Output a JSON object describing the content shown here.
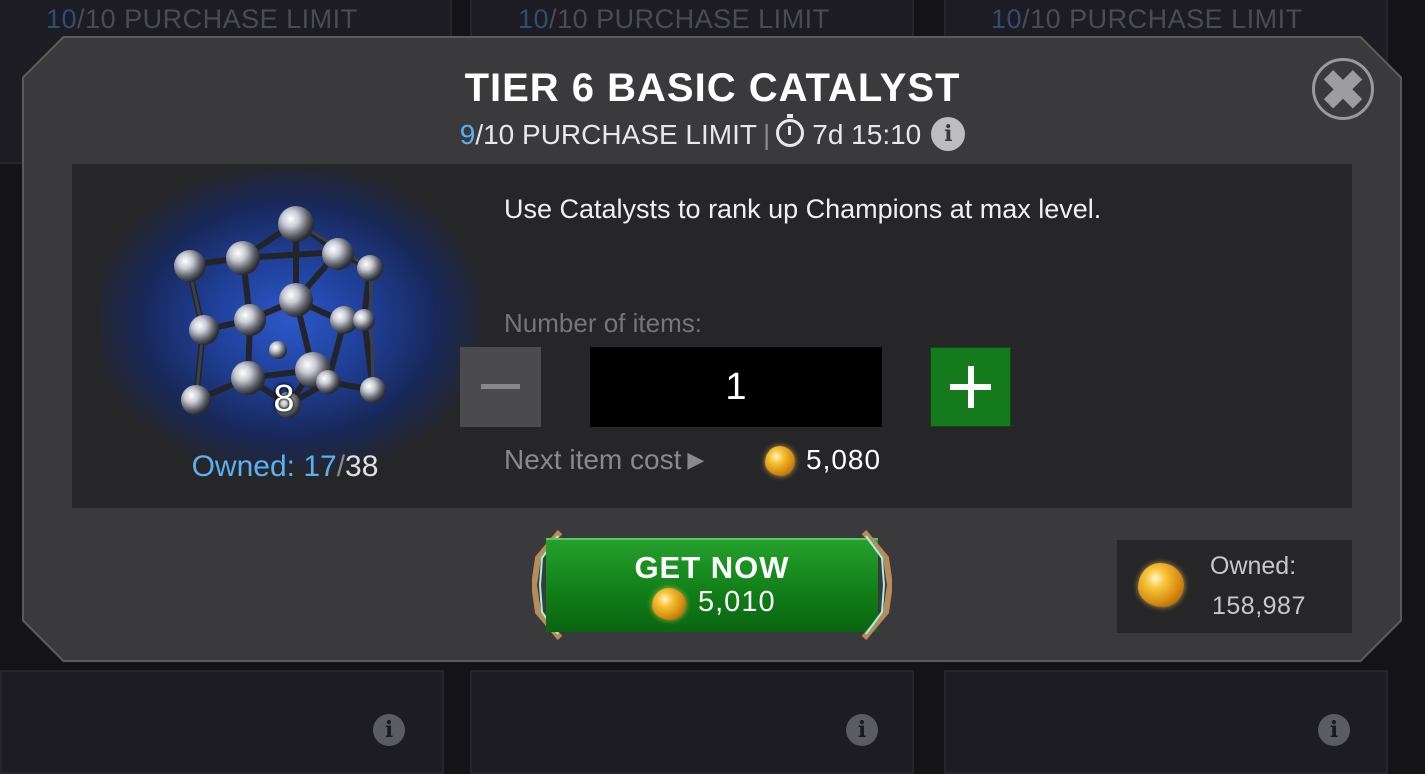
{
  "background": {
    "purchase_limits": [
      {
        "current": "10",
        "slash": "/",
        "text": "10 PURCHASE LIMIT"
      },
      {
        "current": "10",
        "slash": "/",
        "text": "10 PURCHASE LIMIT"
      },
      {
        "current": "10",
        "slash": "/",
        "text": "10 PURCHASE LIMIT"
      }
    ],
    "info_glyph": "i"
  },
  "modal": {
    "title": "TIER 6 BASIC CATALYST",
    "limit_current": "9",
    "limit_rest": "/10 PURCHASE LIMIT",
    "separator": "|",
    "timer": "7d 15:10",
    "info_glyph": "i",
    "close_glyph": "✖",
    "description": "Use Catalysts to rank up Champions at max level.",
    "item": {
      "icon": "catalyst-icon",
      "count": "8",
      "owned_label": "Owned: 17",
      "owned_slash": "/",
      "owned_max": "38"
    },
    "quantity": {
      "label": "Number of items:",
      "value": "1"
    },
    "next_cost": {
      "label": "Next item cost",
      "arrow": "▶",
      "value": "5,080",
      "icon": "crystal-currency-icon"
    },
    "get_now": {
      "label": "GET NOW",
      "price": "5,010"
    },
    "wallet": {
      "label": "Owned:",
      "value": "158,987"
    }
  },
  "colors": {
    "accent_blue": "#5ab0f0",
    "button_green": "#157a1b",
    "modal_bg": "#3a3a3c",
    "panel_bg": "#262628"
  }
}
